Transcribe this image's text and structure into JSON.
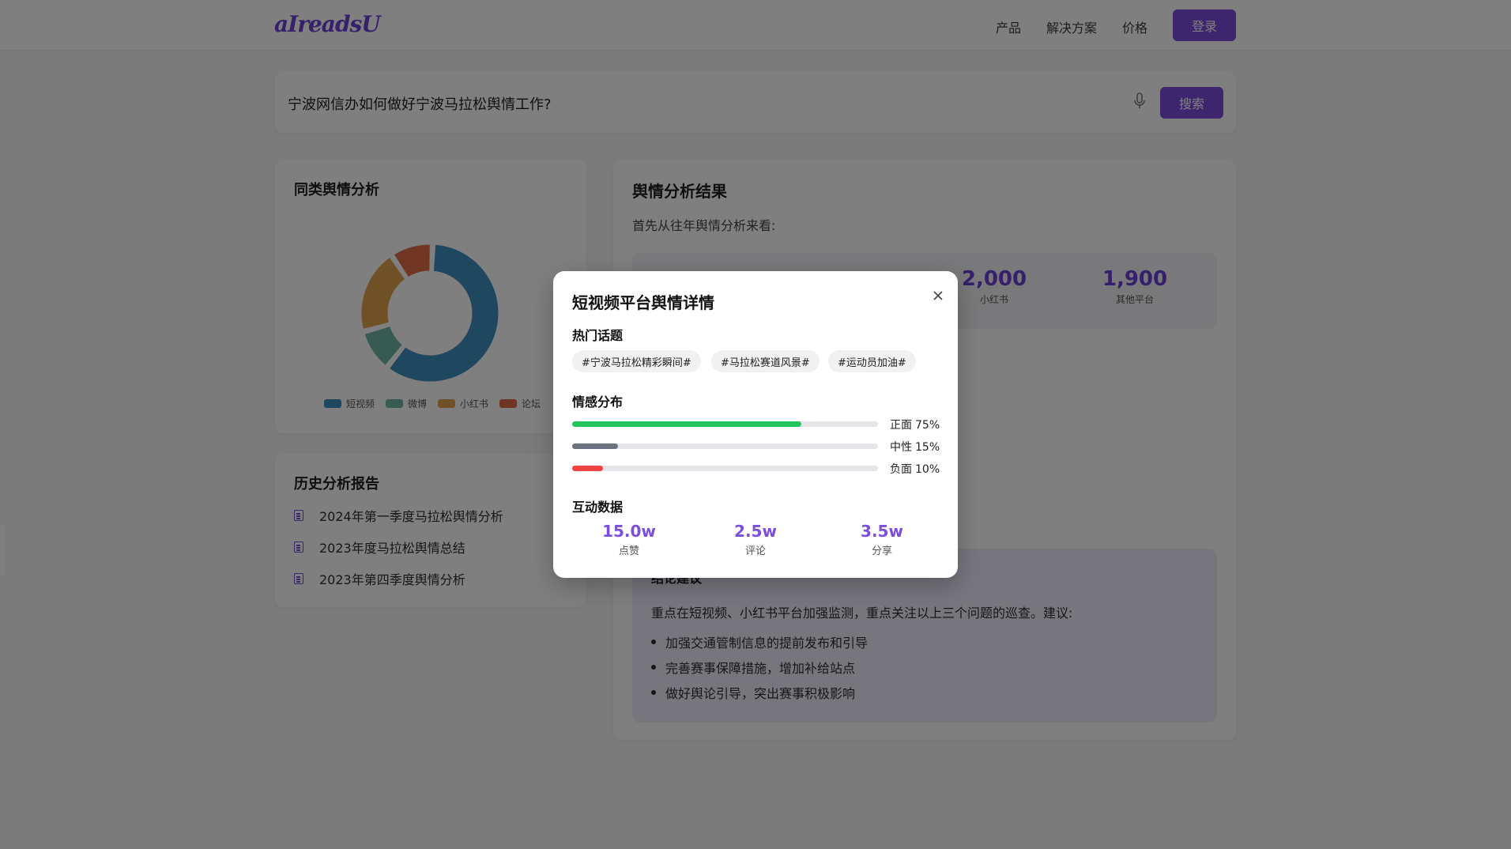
{
  "header": {
    "logo": "aIreadsU",
    "nav": [
      "产品",
      "解决方案",
      "价格"
    ],
    "login_label": "登录"
  },
  "search": {
    "query": "宁波网信办如何做好宁波马拉松舆情工作?",
    "button_label": "搜索",
    "mic_icon": "microphone-icon"
  },
  "similar_analysis": {
    "title": "同类舆情分析",
    "chart_data": {
      "type": "pie",
      "categories": [
        "短视频",
        "微博",
        "小红书",
        "论坛"
      ],
      "values": [
        60,
        10,
        20,
        10
      ],
      "colors": [
        "#3e8fc0",
        "#6fb5a6",
        "#e0a24e",
        "#e06c47"
      ],
      "style": "donut"
    }
  },
  "history": {
    "title": "历史分析报告",
    "items": [
      "2024年第一季度马拉松舆情分析",
      "2023年度马拉松舆情总结",
      "2023年第四季度舆情分析"
    ]
  },
  "results": {
    "title": "舆情分析结果",
    "intro": "首先从往年舆情分析来看:",
    "stats": [
      {
        "value": "2,000",
        "label": "小红书"
      },
      {
        "value": "1,900",
        "label": "其他平台"
      }
    ],
    "conclusion_title": "结论建议",
    "conclusion_text": "重点在短视频、小红书平台加强监测，重点关注以上三个问题的巡查。建议:",
    "suggestions": [
      "加强交通管制信息的提前发布和引导",
      "完善赛事保障措施，增加补给站点",
      "做好舆论引导，突出赛事积极影响"
    ]
  },
  "modal": {
    "title": "短视频平台舆情详情",
    "close_icon": "close-icon",
    "hot_topics_title": "热门话题",
    "hot_topics": [
      "#宁波马拉松精彩瞬间#",
      "#马拉松赛道风景#",
      "#运动员加油#"
    ],
    "sentiment_title": "情感分布",
    "sentiment": [
      {
        "label": "正面",
        "value": "75%",
        "fraction": 0.75,
        "color": "#22c55e"
      },
      {
        "label": "中性",
        "value": "15%",
        "fraction": 0.15,
        "color": "#6b7280"
      },
      {
        "label": "负面",
        "value": "10%",
        "fraction": 0.1,
        "color": "#ef4444"
      }
    ],
    "interaction_title": "互动数据",
    "interactions": [
      {
        "value": "15.0w",
        "label": "点赞"
      },
      {
        "value": "2.5w",
        "label": "评论"
      },
      {
        "value": "3.5w",
        "label": "分享"
      }
    ]
  },
  "colors": {
    "accent": "#7c4ddf",
    "overlay": "rgba(0,0,0,0.5)"
  }
}
